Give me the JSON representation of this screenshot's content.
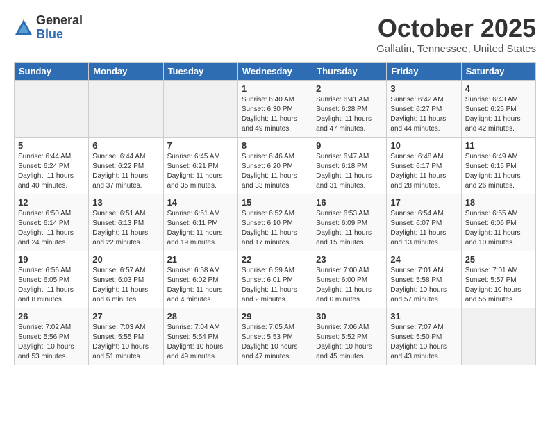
{
  "header": {
    "logo_general": "General",
    "logo_blue": "Blue",
    "month": "October 2025",
    "location": "Gallatin, Tennessee, United States"
  },
  "weekdays": [
    "Sunday",
    "Monday",
    "Tuesday",
    "Wednesday",
    "Thursday",
    "Friday",
    "Saturday"
  ],
  "weeks": [
    [
      {
        "day": "",
        "info": ""
      },
      {
        "day": "",
        "info": ""
      },
      {
        "day": "",
        "info": ""
      },
      {
        "day": "1",
        "info": "Sunrise: 6:40 AM\nSunset: 6:30 PM\nDaylight: 11 hours\nand 49 minutes."
      },
      {
        "day": "2",
        "info": "Sunrise: 6:41 AM\nSunset: 6:28 PM\nDaylight: 11 hours\nand 47 minutes."
      },
      {
        "day": "3",
        "info": "Sunrise: 6:42 AM\nSunset: 6:27 PM\nDaylight: 11 hours\nand 44 minutes."
      },
      {
        "day": "4",
        "info": "Sunrise: 6:43 AM\nSunset: 6:25 PM\nDaylight: 11 hours\nand 42 minutes."
      }
    ],
    [
      {
        "day": "5",
        "info": "Sunrise: 6:44 AM\nSunset: 6:24 PM\nDaylight: 11 hours\nand 40 minutes."
      },
      {
        "day": "6",
        "info": "Sunrise: 6:44 AM\nSunset: 6:22 PM\nDaylight: 11 hours\nand 37 minutes."
      },
      {
        "day": "7",
        "info": "Sunrise: 6:45 AM\nSunset: 6:21 PM\nDaylight: 11 hours\nand 35 minutes."
      },
      {
        "day": "8",
        "info": "Sunrise: 6:46 AM\nSunset: 6:20 PM\nDaylight: 11 hours\nand 33 minutes."
      },
      {
        "day": "9",
        "info": "Sunrise: 6:47 AM\nSunset: 6:18 PM\nDaylight: 11 hours\nand 31 minutes."
      },
      {
        "day": "10",
        "info": "Sunrise: 6:48 AM\nSunset: 6:17 PM\nDaylight: 11 hours\nand 28 minutes."
      },
      {
        "day": "11",
        "info": "Sunrise: 6:49 AM\nSunset: 6:15 PM\nDaylight: 11 hours\nand 26 minutes."
      }
    ],
    [
      {
        "day": "12",
        "info": "Sunrise: 6:50 AM\nSunset: 6:14 PM\nDaylight: 11 hours\nand 24 minutes."
      },
      {
        "day": "13",
        "info": "Sunrise: 6:51 AM\nSunset: 6:13 PM\nDaylight: 11 hours\nand 22 minutes."
      },
      {
        "day": "14",
        "info": "Sunrise: 6:51 AM\nSunset: 6:11 PM\nDaylight: 11 hours\nand 19 minutes."
      },
      {
        "day": "15",
        "info": "Sunrise: 6:52 AM\nSunset: 6:10 PM\nDaylight: 11 hours\nand 17 minutes."
      },
      {
        "day": "16",
        "info": "Sunrise: 6:53 AM\nSunset: 6:09 PM\nDaylight: 11 hours\nand 15 minutes."
      },
      {
        "day": "17",
        "info": "Sunrise: 6:54 AM\nSunset: 6:07 PM\nDaylight: 11 hours\nand 13 minutes."
      },
      {
        "day": "18",
        "info": "Sunrise: 6:55 AM\nSunset: 6:06 PM\nDaylight: 11 hours\nand 10 minutes."
      }
    ],
    [
      {
        "day": "19",
        "info": "Sunrise: 6:56 AM\nSunset: 6:05 PM\nDaylight: 11 hours\nand 8 minutes."
      },
      {
        "day": "20",
        "info": "Sunrise: 6:57 AM\nSunset: 6:03 PM\nDaylight: 11 hours\nand 6 minutes."
      },
      {
        "day": "21",
        "info": "Sunrise: 6:58 AM\nSunset: 6:02 PM\nDaylight: 11 hours\nand 4 minutes."
      },
      {
        "day": "22",
        "info": "Sunrise: 6:59 AM\nSunset: 6:01 PM\nDaylight: 11 hours\nand 2 minutes."
      },
      {
        "day": "23",
        "info": "Sunrise: 7:00 AM\nSunset: 6:00 PM\nDaylight: 11 hours\nand 0 minutes."
      },
      {
        "day": "24",
        "info": "Sunrise: 7:01 AM\nSunset: 5:58 PM\nDaylight: 10 hours\nand 57 minutes."
      },
      {
        "day": "25",
        "info": "Sunrise: 7:01 AM\nSunset: 5:57 PM\nDaylight: 10 hours\nand 55 minutes."
      }
    ],
    [
      {
        "day": "26",
        "info": "Sunrise: 7:02 AM\nSunset: 5:56 PM\nDaylight: 10 hours\nand 53 minutes."
      },
      {
        "day": "27",
        "info": "Sunrise: 7:03 AM\nSunset: 5:55 PM\nDaylight: 10 hours\nand 51 minutes."
      },
      {
        "day": "28",
        "info": "Sunrise: 7:04 AM\nSunset: 5:54 PM\nDaylight: 10 hours\nand 49 minutes."
      },
      {
        "day": "29",
        "info": "Sunrise: 7:05 AM\nSunset: 5:53 PM\nDaylight: 10 hours\nand 47 minutes."
      },
      {
        "day": "30",
        "info": "Sunrise: 7:06 AM\nSunset: 5:52 PM\nDaylight: 10 hours\nand 45 minutes."
      },
      {
        "day": "31",
        "info": "Sunrise: 7:07 AM\nSunset: 5:50 PM\nDaylight: 10 hours\nand 43 minutes."
      },
      {
        "day": "",
        "info": ""
      }
    ]
  ]
}
